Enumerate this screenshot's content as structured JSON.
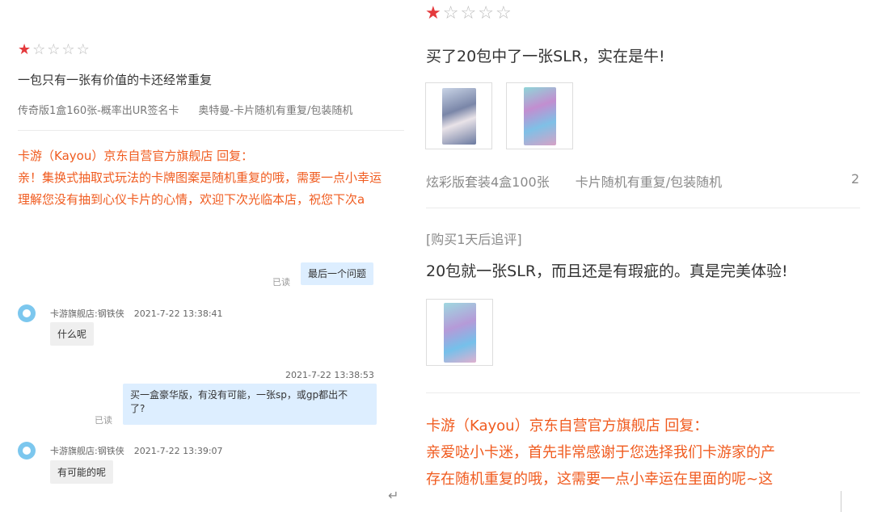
{
  "left_review": {
    "rating": 1,
    "max_rating": 5,
    "title": "一包只有一张有价值的卡还经常重复",
    "meta": [
      "传奇版1盒160张-概率出UR签名卡",
      "奥特曼-卡片随机有重复/包装随机"
    ],
    "reply_header": "卡游（Kayou）京东自营官方旗舰店 回复：",
    "reply_lines": [
      "亲！集换式抽取式玩法的卡牌图案是随机重复的哦，需要一点小幸运",
      "理解您没有抽到心仪卡片的心情，欢迎下次光临本店，祝您下次a"
    ]
  },
  "chat": {
    "msg1": {
      "read": "已读",
      "text": "最后一个问题"
    },
    "msg2": {
      "name": "卡游旗舰店:钢铁侠",
      "time": "2021-7-22 13:38:41",
      "text": "什么呢"
    },
    "msg3": {
      "time": "2021-7-22 13:38:53",
      "read": "已读",
      "line1": "买一盒豪华版，有没有可能，一张sp，或gp都出不",
      "line2": "了?"
    },
    "msg4": {
      "name": "卡游旗舰店:钢铁侠",
      "time": "2021-7-22 13:39:07",
      "text": "有可能的呢"
    },
    "return_icon": "↵"
  },
  "right_review": {
    "rating": 1,
    "max_rating": 5,
    "title": "买了20包中了一张SLR，实在是牛!",
    "meta": [
      "炫彩版套装4盒100张",
      "卡片随机有重复/包装随机"
    ],
    "meta_count": "2",
    "followup_label": "[购买1天后追评]",
    "followup_text": "20包就一张SLR，而且还是有瑕疵的。真是完美体验!",
    "reply_header": "卡游（Kayou）京东自营官方旗舰店 回复：",
    "reply_lines": [
      "亲爱哒小卡迷，首先非常感谢于您选择我们卡游家的产",
      "存在随机重复的哦，这需要一点小幸运在里面的呢~这"
    ]
  },
  "colors": {
    "accent": "#e4393c",
    "reply": "#f05b1f",
    "bubble_right": "#ddeeff",
    "bubble_left": "#efefef"
  },
  "icons": {
    "star": "star-icon",
    "avatar": "avatar-icon"
  }
}
